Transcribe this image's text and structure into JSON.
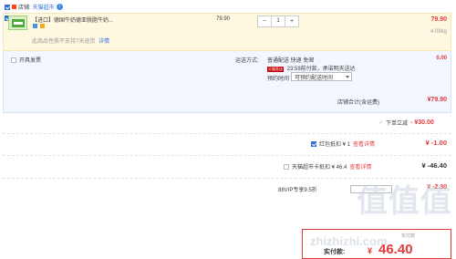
{
  "store": {
    "label": "店铺:",
    "name": "天猫超市",
    "info_icon": "i"
  },
  "item": {
    "title": "【进口】德国牛奶德亚脱脂牛奶...",
    "return_policy": "此商品性质不支持7天退货",
    "detail_link": "详情",
    "unit_price": "79.90",
    "quantity": "1",
    "minus": "−",
    "plus": "+",
    "subtotal": "79.90",
    "weight": "4.08kg"
  },
  "order": {
    "invoice_label": "开具发票",
    "shipping_label": "运送方式:",
    "shipping_value": "普通配送 快递 免邮",
    "shipping_fee": "0.00",
    "tmall_tag": "天猫直送",
    "delivery_note": "23:59前付款，承诺明天送达",
    "appointment_label": "预约时间",
    "appointment_value": "可预约配送时间",
    "store_total_label": "店铺合计(含运费)",
    "store_total_value": "¥79.90"
  },
  "discounts": {
    "instant": {
      "label": "下单立减",
      "value": "- ¥30.00"
    },
    "red_packet": {
      "label": "红包抵扣 ¥ 1",
      "link": "查看详情",
      "value": "¥ -1.00"
    },
    "card": {
      "label": "天猫超市卡抵扣 ¥ 46.4",
      "link": "查看详情",
      "value": "¥ -46.40"
    },
    "vip": {
      "label": "88VIP专享9.5折",
      "value": "¥ -2.30"
    }
  },
  "total": {
    "label": "实付款:",
    "currency": "¥",
    "value": "46.40",
    "label_small": "实付款"
  },
  "watermark": {
    "logo": "值值值",
    "url": "zhizhizhi.com"
  },
  "colors": {
    "price_red": "#e4393c",
    "tmall_red": "#c40000",
    "link_blue": "#3a6ee0"
  }
}
